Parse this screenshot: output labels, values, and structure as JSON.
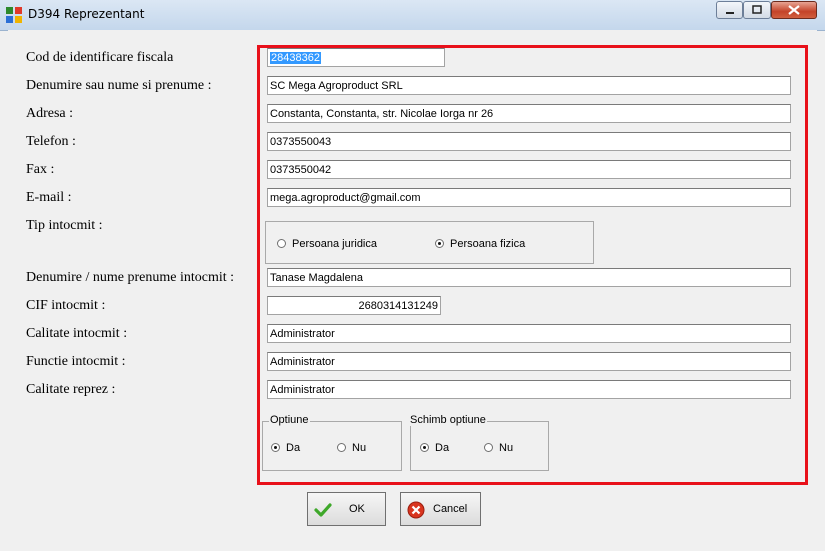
{
  "window": {
    "title": "D394 Reprezentant"
  },
  "labels": {
    "cif": "Cod de identificare fiscala",
    "denumire": "Denumire sau nume si prenume :",
    "adresa": "Adresa :",
    "telefon": "Telefon :",
    "fax": "Fax :",
    "email": "E-mail :",
    "tip": "Tip intocmit :",
    "denumire_intocmit": "Denumire / nume prenume intocmit :",
    "cif_intocmit": "CIF intocmit :",
    "calitate_intocmit": "Calitate intocmit :",
    "functie_intocmit": "Functie intocmit :",
    "calitate_reprez": "Calitate reprez :"
  },
  "values": {
    "cif": "28438362",
    "denumire": "SC Mega Agroproduct SRL",
    "adresa": "Constanta, Constanta, str. Nicolae Iorga nr 26",
    "telefon": "0373550043",
    "fax": "0373550042",
    "email": "mega.agroproduct@gmail.com",
    "denumire_intocmit": "Tanase Magdalena",
    "cif_intocmit": "2680314131249",
    "calitate_intocmit": "Administrator",
    "functie_intocmit": "Administrator",
    "calitate_reprez": "Administrator"
  },
  "tip_intocmit": {
    "options": [
      "Persoana juridica",
      "Persoana fizica"
    ],
    "selected": "Persoana fizica"
  },
  "optiune": {
    "title": "Optiune",
    "options": [
      "Da",
      "Nu"
    ],
    "selected": "Da"
  },
  "schimb_optiune": {
    "title": "Schimb optiune",
    "options": [
      "Da",
      "Nu"
    ],
    "selected": "Da"
  },
  "buttons": {
    "ok": "OK",
    "cancel": "Cancel"
  },
  "colors": {
    "highlight": "#e8101a",
    "selection": "#3399ff"
  }
}
